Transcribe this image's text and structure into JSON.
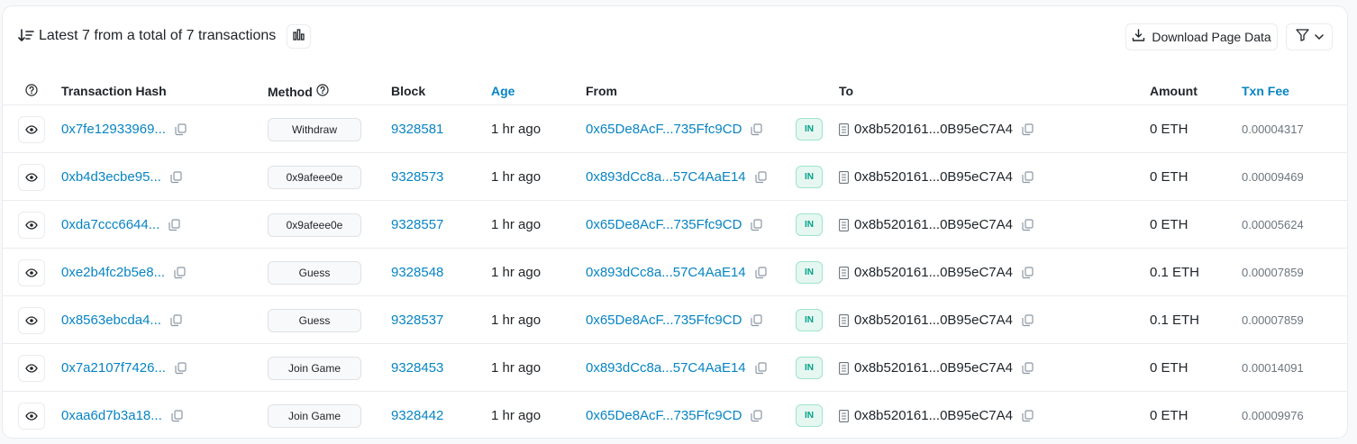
{
  "header": {
    "title": "Latest 7 from a total of 7 transactions",
    "download_label": "Download Page Data"
  },
  "columns": {
    "hash": "Transaction Hash",
    "method": "Method",
    "block": "Block",
    "age": "Age",
    "from": "From",
    "to": "To",
    "amount": "Amount",
    "fee": "Txn Fee"
  },
  "rows": [
    {
      "hash": "0x7fe12933969...",
      "method": "Withdraw",
      "block": "9328581",
      "age": "1 hr ago",
      "from": "0x65De8AcF...735Ffc9CD",
      "direction": "IN",
      "to": "0x8b520161...0B95eC7A4",
      "amount": "0 ETH",
      "fee": "0.00004317"
    },
    {
      "hash": "0xb4d3ecbe95...",
      "method": "0x9afeee0e",
      "block": "9328573",
      "age": "1 hr ago",
      "from": "0x893dCc8a...57C4AaE14",
      "direction": "IN",
      "to": "0x8b520161...0B95eC7A4",
      "amount": "0 ETH",
      "fee": "0.00009469"
    },
    {
      "hash": "0xda7ccc6644...",
      "method": "0x9afeee0e",
      "block": "9328557",
      "age": "1 hr ago",
      "from": "0x65De8AcF...735Ffc9CD",
      "direction": "IN",
      "to": "0x8b520161...0B95eC7A4",
      "amount": "0 ETH",
      "fee": "0.00005624"
    },
    {
      "hash": "0xe2b4fc2b5e8...",
      "method": "Guess",
      "block": "9328548",
      "age": "1 hr ago",
      "from": "0x893dCc8a...57C4AaE14",
      "direction": "IN",
      "to": "0x8b520161...0B95eC7A4",
      "amount": "0.1 ETH",
      "fee": "0.00007859"
    },
    {
      "hash": "0x8563ebcda4...",
      "method": "Guess",
      "block": "9328537",
      "age": "1 hr ago",
      "from": "0x65De8AcF...735Ffc9CD",
      "direction": "IN",
      "to": "0x8b520161...0B95eC7A4",
      "amount": "0.1 ETH",
      "fee": "0.00007859"
    },
    {
      "hash": "0x7a2107f7426...",
      "method": "Join Game",
      "block": "9328453",
      "age": "1 hr ago",
      "from": "0x893dCc8a...57C4AaE14",
      "direction": "IN",
      "to": "0x8b520161...0B95eC7A4",
      "amount": "0 ETH",
      "fee": "0.00014091"
    },
    {
      "hash": "0xaa6d7b3a18...",
      "method": "Join Game",
      "block": "9328442",
      "age": "1 hr ago",
      "from": "0x65De8AcF...735Ffc9CD",
      "direction": "IN",
      "to": "0x8b520161...0B95eC7A4",
      "amount": "0 ETH",
      "fee": "0.00009976"
    }
  ],
  "icons": {
    "sort": "sort-descending-icon",
    "chart": "bar-chart-icon",
    "download": "download-icon",
    "filter": "filter-icon",
    "help": "question-circle-icon",
    "eye": "eye-icon",
    "copy": "copy-icon",
    "contract": "contract-document-icon"
  },
  "colors": {
    "link": "#0784c3",
    "in_badge_text": "#00a186",
    "in_badge_bg": "#e6f7f1",
    "border": "#e9ecef"
  }
}
